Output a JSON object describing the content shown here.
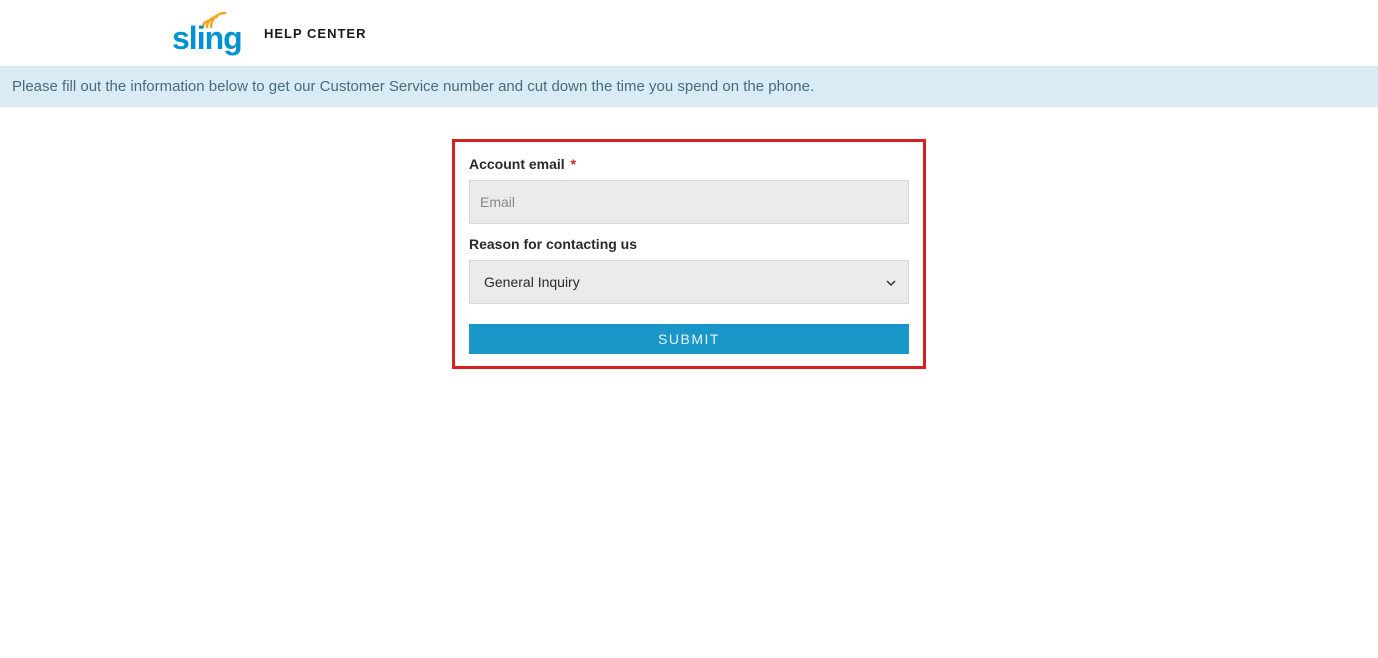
{
  "header": {
    "logo_text": "sling",
    "help_center_label": "HELP CENTER"
  },
  "banner": {
    "message": "Please fill out the information below to get our Customer Service number and cut down the time you spend on the phone."
  },
  "form": {
    "email_label": "Account email",
    "email_placeholder": "Email",
    "email_value": "",
    "reason_label": "Reason for contacting us",
    "reason_selected": "General Inquiry",
    "submit_label": "SUBMIT"
  },
  "colors": {
    "accent": "#1a97c9",
    "banner_bg": "#d9ecf5",
    "highlight_border": "#d92020",
    "logo_blue": "#0093cf",
    "logo_orange": "#f5a623"
  }
}
